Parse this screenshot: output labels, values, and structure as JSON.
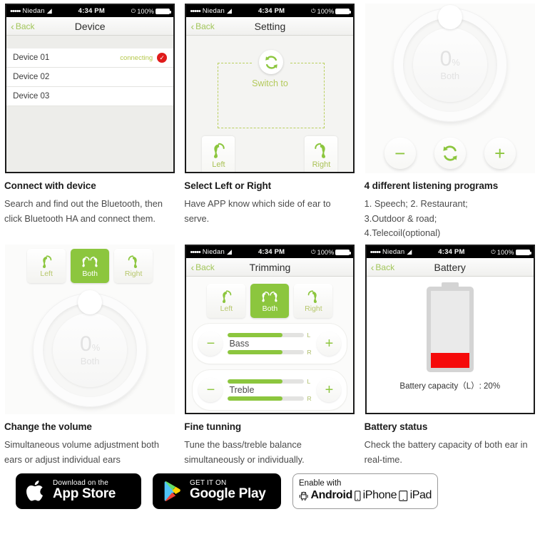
{
  "statusbar": {
    "carrier": "Niedan",
    "time": "4:34 PM",
    "battery_percent": "100%",
    "wifi_icon": "wifi-icon",
    "dots": "•••••"
  },
  "panels": {
    "device": {
      "back_label": "Back",
      "title": "Device",
      "rows": [
        {
          "name": "Device 01",
          "status": "connecting",
          "checked": true
        },
        {
          "name": "Device 02",
          "status": "",
          "checked": false
        },
        {
          "name": "Device 03",
          "status": "",
          "checked": false
        }
      ]
    },
    "setting": {
      "back_label": "Back",
      "title": "Setting",
      "switch_label": "Switch to",
      "left_label": "Left",
      "right_label": "Right",
      "switch_icon": "refresh-icon"
    },
    "volume_programs": {
      "dial_value": "0",
      "dial_percent": "%",
      "dial_side": "Both",
      "minus_label": "−",
      "plus_label": "+",
      "cycle_icon": "refresh-icon"
    },
    "volume_change": {
      "segments": [
        {
          "label": "Left",
          "active": false
        },
        {
          "label": "Both",
          "active": true
        },
        {
          "label": "Right",
          "active": false
        }
      ],
      "dial_value": "0",
      "dial_percent": "%",
      "dial_side": "Both"
    },
    "trimming": {
      "back_label": "Back",
      "title": "Trimming",
      "segments": [
        {
          "label": "Left",
          "active": false
        },
        {
          "label": "Both",
          "active": true
        },
        {
          "label": "Right",
          "active": false
        }
      ],
      "sliders": [
        {
          "name": "Bass",
          "minus": "−",
          "plus": "+",
          "left_label": "L",
          "right_label": "R",
          "left_value": 72,
          "right_value": 72
        },
        {
          "name": "Treble",
          "minus": "−",
          "plus": "+",
          "left_label": "L",
          "right_label": "R",
          "left_value": 72,
          "right_value": 72
        }
      ]
    },
    "battery": {
      "back_label": "Back",
      "title": "Battery",
      "fill_percent": 20,
      "caption": "Battery capacity（L）: 20%"
    }
  },
  "captions": [
    {
      "title": "Connect with device",
      "body": "Search and find out the Bluetooth, then click Bluetooth HA and connect them."
    },
    {
      "title": "Select Left or Right",
      "body": "Have APP know which side of ear to serve."
    },
    {
      "title": "4 different listening programs",
      "body": "1. Speech; 2. Restaurant;\n3.Outdoor & road;\n4.Telecoil(optional)"
    },
    {
      "title": "Change the volume",
      "body": "Simultaneous volume adjustment both ears or adjust individual ears"
    },
    {
      "title": "Fine tunning",
      "body": "Tune the bass/treble balance simultaneously or individually."
    },
    {
      "title": "Battery status",
      "body": "Check the battery capacity of both ear in real-time."
    }
  ],
  "badges": {
    "apple": {
      "small": "Download on the",
      "large": "App Store",
      "icon": "apple-logo-icon"
    },
    "google": {
      "small": "GET IT ON",
      "large": "Google Play",
      "icon": "google-play-icon"
    },
    "enable": {
      "title": "Enable with",
      "android": "Android",
      "iphone": "iPhone",
      "ipad": "iPad",
      "android_icon": "android-robot-icon",
      "iphone_icon": "iphone-icon",
      "ipad_icon": "ipad-icon"
    }
  },
  "colors": {
    "brand_green": "#8cc63e",
    "label_green": "#b3c95a",
    "alert_red": "#e01b1b",
    "battery_red": "#f50a0a"
  }
}
